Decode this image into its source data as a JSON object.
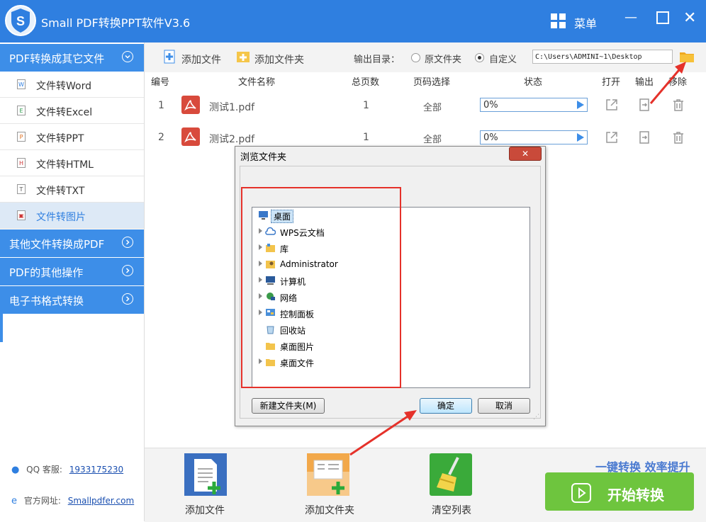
{
  "app": {
    "title": "Small PDF转换PPT软件V3.6",
    "menu_label": "菜单",
    "min_icon": "minimize-icon",
    "max_icon": "maximize-icon",
    "close_icon": "close-icon"
  },
  "colors": {
    "brand": "#2f7fe0",
    "sidebar_cat": "#3d8ee8",
    "start": "#6ec53e",
    "highlight": "#e5312a"
  },
  "sidebar": {
    "cat1": "PDF转换成其它文件",
    "items": [
      {
        "label": "文件转Word",
        "icon": "W"
      },
      {
        "label": "文件转Excel",
        "icon": "E"
      },
      {
        "label": "文件转PPT",
        "icon": "P"
      },
      {
        "label": "文件转HTML",
        "icon": "H"
      },
      {
        "label": "文件转TXT",
        "icon": "T"
      },
      {
        "label": "文件转图片",
        "icon": "image-file-icon"
      }
    ],
    "cat2": "其他文件转换成PDF",
    "cat3": "PDF的其他操作",
    "cat4": "电子书格式转换",
    "qq_label": "QQ 客服:",
    "qq_value": "1933175230",
    "web_label": "官方网址:",
    "web_value": "Smallpdfer.com"
  },
  "toolbar": {
    "add_file": "添加文件",
    "add_folder": "添加文件夹",
    "out_dir_label": "输出目录：",
    "opt_original": "原文件夹",
    "opt_custom": "自定义",
    "selected_option": "自定义",
    "path": "C:\\Users\\ADMINI~1\\Desktop"
  },
  "table": {
    "headers": [
      "编号",
      "文件名称",
      "总页数",
      "页码选择",
      "状态",
      "打开",
      "输出",
      "移除"
    ],
    "rows": [
      {
        "no": "1",
        "name": "测试1.pdf",
        "pages": "1",
        "range": "全部",
        "progress": "0%"
      },
      {
        "no": "2",
        "name": "测试2.pdf",
        "pages": "1",
        "range": "全部",
        "progress": "0%"
      }
    ]
  },
  "dialog": {
    "title": "浏览文件夹",
    "close": "✕",
    "tree": [
      {
        "label": "桌面",
        "icon": "desktop-icon",
        "expandable": false,
        "selected": true
      },
      {
        "label": "WPS云文档",
        "icon": "cloud-icon",
        "expandable": true
      },
      {
        "label": "库",
        "icon": "library-icon",
        "expandable": true
      },
      {
        "label": "Administrator",
        "icon": "user-folder-icon",
        "expandable": true
      },
      {
        "label": "计算机",
        "icon": "computer-icon",
        "expandable": true
      },
      {
        "label": "网络",
        "icon": "network-icon",
        "expandable": true
      },
      {
        "label": "控制面板",
        "icon": "control-panel-icon",
        "expandable": true
      },
      {
        "label": "回收站",
        "icon": "recycle-bin-icon",
        "expandable": false
      },
      {
        "label": "桌面图片",
        "icon": "folder-icon",
        "expandable": false
      },
      {
        "label": "桌面文件",
        "icon": "folder-icon",
        "expandable": true
      }
    ],
    "new_folder": "新建文件夹(M)",
    "ok": "确定",
    "cancel": "取消"
  },
  "bottom": {
    "add_file": "添加文件",
    "add_folder": "添加文件夹",
    "clear": "清空列表",
    "slogan": "一键转换  效率提升",
    "start": "开始转换"
  }
}
